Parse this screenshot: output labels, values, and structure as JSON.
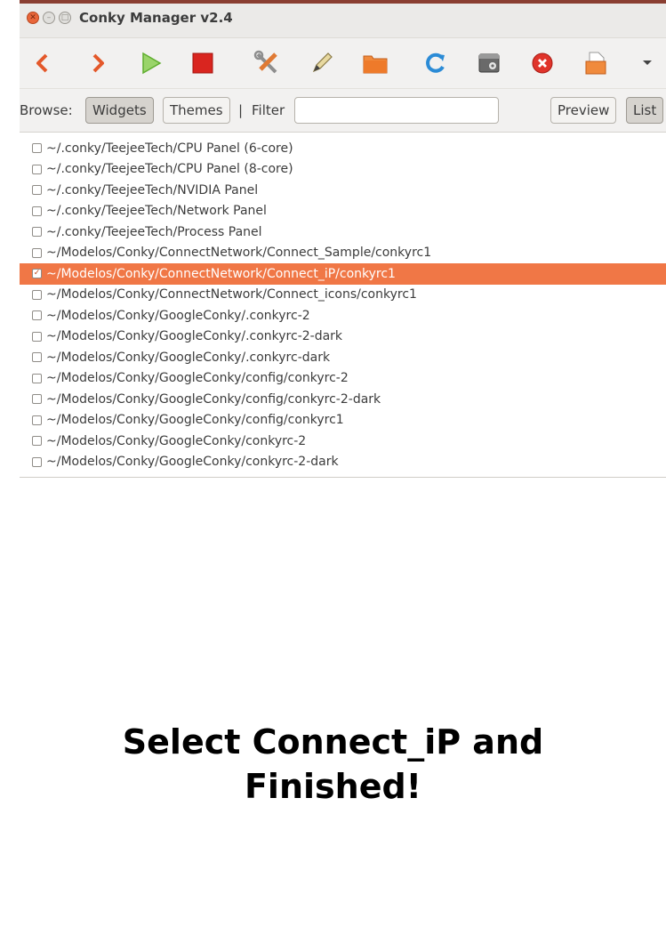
{
  "window": {
    "title": "Conky Manager v2.4",
    "controls": [
      "close",
      "minimize",
      "maximize"
    ]
  },
  "toolbar": {
    "buttons": [
      {
        "icon": "chevron-left-icon",
        "color": "#e4582a"
      },
      {
        "icon": "chevron-right-icon",
        "color": "#e4582a"
      },
      {
        "icon": "play-icon",
        "color": "#6bbf3c"
      },
      {
        "icon": "stop-icon",
        "color": "#d9251f"
      },
      {
        "icon": "tools-icon",
        "color": "#9a9a9a"
      },
      {
        "icon": "pencil-icon",
        "color": "#c9b36a"
      },
      {
        "icon": "folder-icon",
        "color": "#e9762f"
      },
      {
        "icon": "refresh-icon",
        "color": "#2b8bd6"
      },
      {
        "icon": "settings-window-icon",
        "color": "#555555"
      },
      {
        "icon": "close-circle-icon",
        "color": "#e0342b"
      },
      {
        "icon": "import-icon",
        "color": "#e9762f"
      },
      {
        "icon": "dropdown-arrow-icon",
        "color": "#444444"
      }
    ]
  },
  "browse": {
    "label": "Browse:",
    "widgets_label": "Widgets",
    "themes_label": "Themes",
    "separator": "|",
    "filter_label": "Filter",
    "filter_value": "",
    "preview_label": "Preview",
    "list_label": "List"
  },
  "list": {
    "items": [
      {
        "label": "~/.conky/TeejeeTech/CPU Panel (6-core)",
        "checked": false
      },
      {
        "label": "~/.conky/TeejeeTech/CPU Panel (8-core)",
        "checked": false
      },
      {
        "label": "~/.conky/TeejeeTech/NVIDIA Panel",
        "checked": false
      },
      {
        "label": "~/.conky/TeejeeTech/Network Panel",
        "checked": false
      },
      {
        "label": "~/.conky/TeejeeTech/Process Panel",
        "checked": false
      },
      {
        "label": "~/Modelos/Conky/ConnectNetwork/Connect_Sample/conkyrc1",
        "checked": false
      },
      {
        "label": "~/Modelos/Conky/ConnectNetwork/Connect_iP/conkyrc1",
        "checked": true
      },
      {
        "label": "~/Modelos/Conky/ConnectNetwork/Connect_icons/conkyrc1",
        "checked": false
      },
      {
        "label": "~/Modelos/Conky/GoogleConky/.conkyrc-2",
        "checked": false
      },
      {
        "label": "~/Modelos/Conky/GoogleConky/.conkyrc-2-dark",
        "checked": false
      },
      {
        "label": "~/Modelos/Conky/GoogleConky/.conkyrc-dark",
        "checked": false
      },
      {
        "label": "~/Modelos/Conky/GoogleConky/config/conkyrc-2",
        "checked": false
      },
      {
        "label": "~/Modelos/Conky/GoogleConky/config/conkyrc-2-dark",
        "checked": false
      },
      {
        "label": "~/Modelos/Conky/GoogleConky/config/conkyrc1",
        "checked": false
      },
      {
        "label": "~/Modelos/Conky/GoogleConky/conkyrc-2",
        "checked": false
      },
      {
        "label": "~/Modelos/Conky/GoogleConky/conkyrc-2-dark",
        "checked": false
      }
    ],
    "selection_color": "#f07746"
  },
  "caption": {
    "line1": "Select Connect_iP and",
    "line2": "Finished!"
  }
}
